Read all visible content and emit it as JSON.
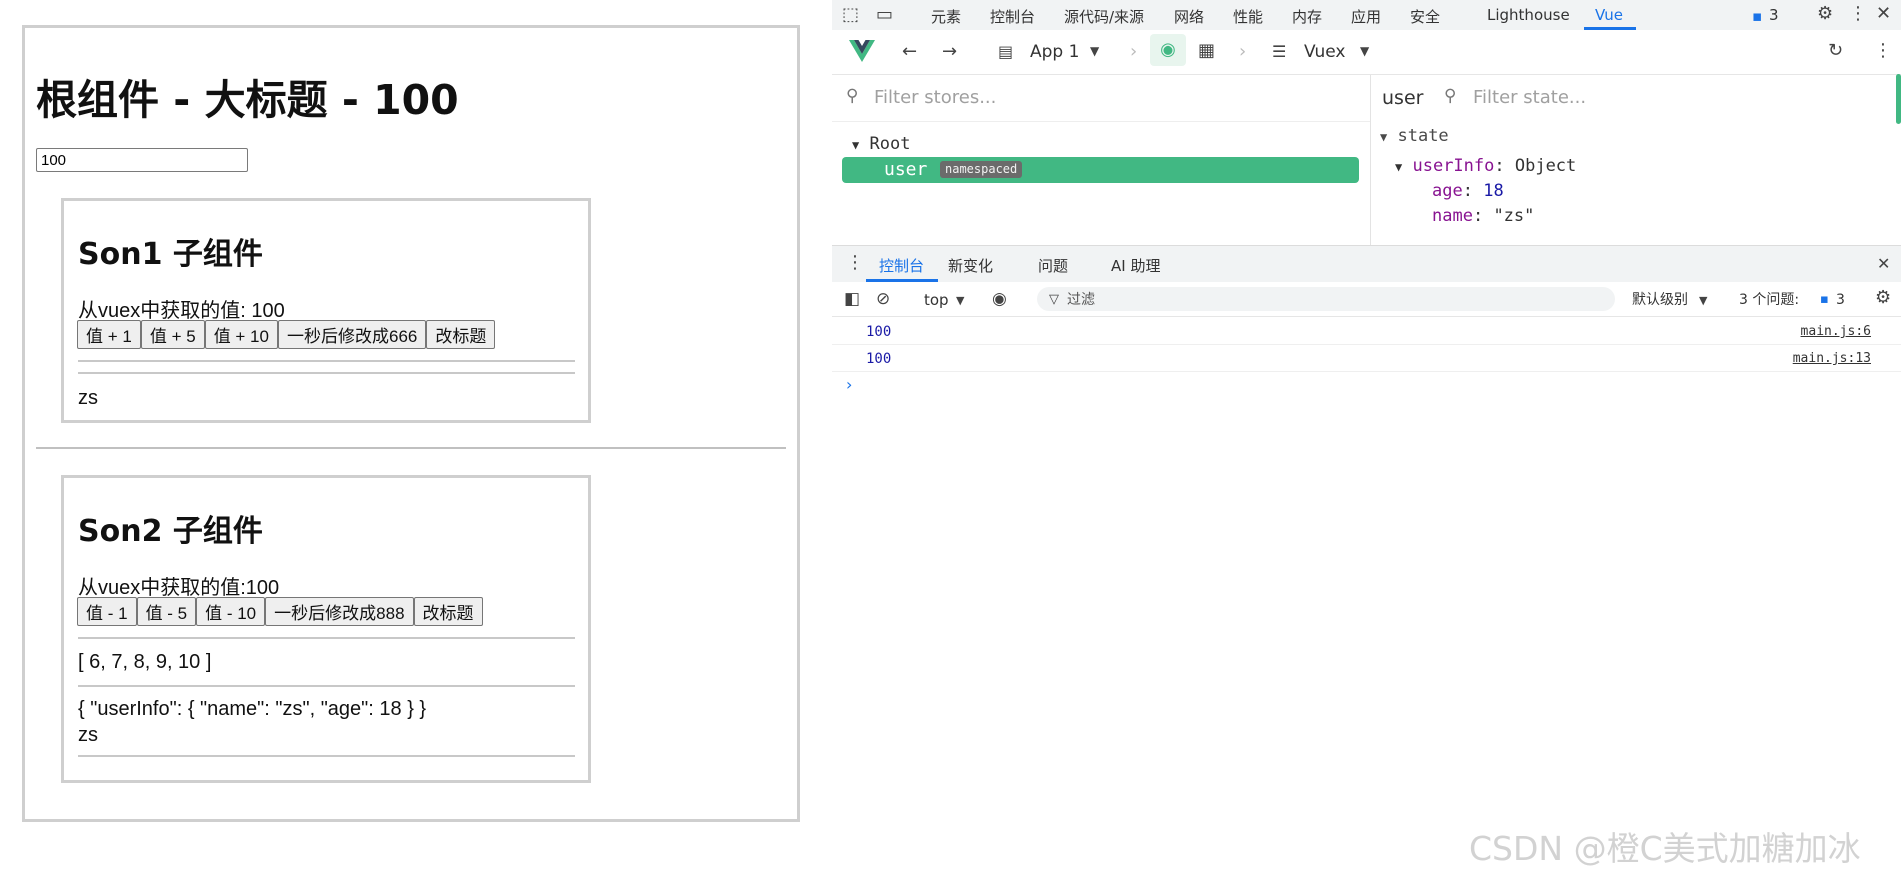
{
  "app": {
    "root_title": "根组件 - 大标题 - 100",
    "input_value": "100",
    "son1": {
      "title": "Son1 子组件",
      "vuex_value_text": "从vuex中获取的值: 100",
      "buttons": [
        "值 + 1",
        "值 + 5",
        "值 + 10",
        "一秒后修改成666",
        "改标题"
      ],
      "name_text": "zs"
    },
    "son2": {
      "title": "Son2 子组件",
      "vuex_value_text": "从vuex中获取的值:100",
      "buttons": [
        "值 - 1",
        "值 - 5",
        "值 - 10",
        "一秒后修改成888",
        "改标题"
      ],
      "list_text": "[ 6, 7, 8, 9, 10 ]",
      "json_text": "{ \"userInfo\": { \"name\": \"zs\", \"age\": 18 } }",
      "name_text": "zs"
    }
  },
  "devtools": {
    "tabs": [
      "元素",
      "控制台",
      "源代码/来源",
      "网络",
      "性能",
      "内存",
      "应用",
      "安全",
      "Lighthouse",
      "Vue"
    ],
    "active_tab": "Vue",
    "issues_count": "3",
    "vue_toolbar": {
      "app_label": "App 1",
      "store_label": "Vuex"
    },
    "stores_filter_placeholder": "Filter stores...",
    "state_filter_placeholder": "Filter state...",
    "selected_module": "user",
    "tree": {
      "root_label": "Root",
      "user_label": "user",
      "badge": "namespaced"
    },
    "state": {
      "section": "state",
      "userInfo_key": "userInfo",
      "userInfo_type": "Object",
      "age_key": "age",
      "age_value": "18",
      "name_key": "name",
      "name_value": "\"zs\""
    },
    "console_tabs": [
      "控制台",
      "新变化",
      "问题",
      "AI 助理"
    ],
    "console_toolbar": {
      "context": "top",
      "filter_placeholder": "过滤",
      "level": "默认级别",
      "issues_text": "3 个问题:",
      "issues_count": "3"
    },
    "logs": [
      {
        "value": "100",
        "source": "main.js:6"
      },
      {
        "value": "100",
        "source": "main.js:13"
      }
    ],
    "accent_color": "#41b883",
    "active_tab_color": "#1a73e8"
  },
  "watermark": "CSDN @橙C美式加糖加冰"
}
